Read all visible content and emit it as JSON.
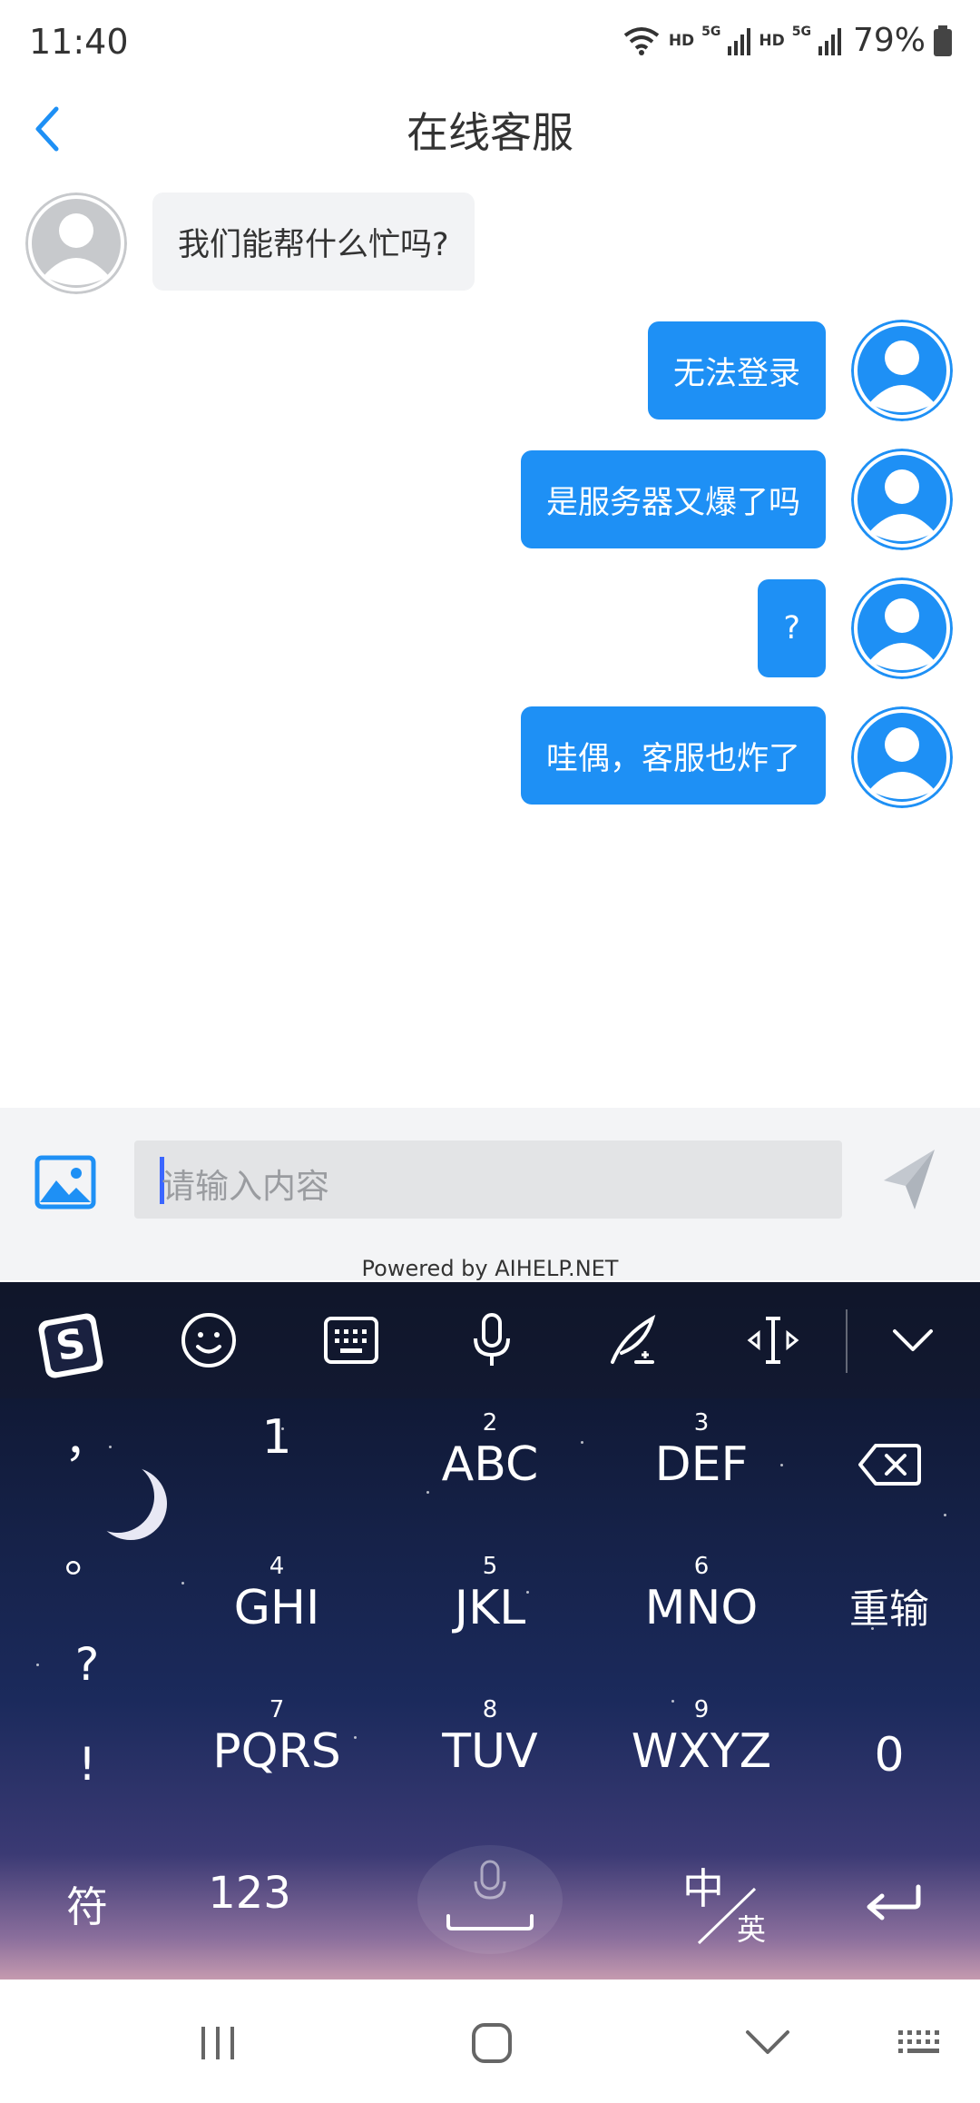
{
  "status": {
    "time": "11:40",
    "hd1": "HD",
    "hd2": "HD",
    "net1": "5G",
    "net2": "5G",
    "battery": "79%"
  },
  "header": {
    "title": "在线客服"
  },
  "messages": {
    "agent_1": "我们能帮什么忙吗?",
    "user_1": "无法登录",
    "user_2": "是服务器又爆了吗",
    "user_3": "?",
    "user_4": "哇偶，客服也炸了"
  },
  "input": {
    "placeholder": "请输入内容",
    "powered_by": "Powered by AIHELP.NET"
  },
  "keyboard": {
    "punct_comma": "，",
    "punct_period": "。",
    "punct_question": "?",
    "punct_exclaim": "!",
    "k1": {
      "num": "",
      "label": "1"
    },
    "k2": {
      "num": "2",
      "label": "ABC"
    },
    "k3": {
      "num": "3",
      "label": "DEF"
    },
    "k4": {
      "num": "4",
      "label": "GHI"
    },
    "k5": {
      "num": "5",
      "label": "JKL"
    },
    "k6": {
      "num": "6",
      "label": "MNO"
    },
    "k7": {
      "num": "7",
      "label": "PQRS"
    },
    "k8": {
      "num": "8",
      "label": "TUV"
    },
    "k9": {
      "num": "9",
      "label": "WXYZ"
    },
    "k0": "0",
    "reset": "重输",
    "symbols": "符",
    "numbers": "123",
    "lang_zh": "中",
    "lang_en": "英"
  },
  "colors": {
    "accent": "#1e90f5",
    "agent_bubble": "#f2f3f5",
    "input_bg": "#e3e4e6"
  }
}
